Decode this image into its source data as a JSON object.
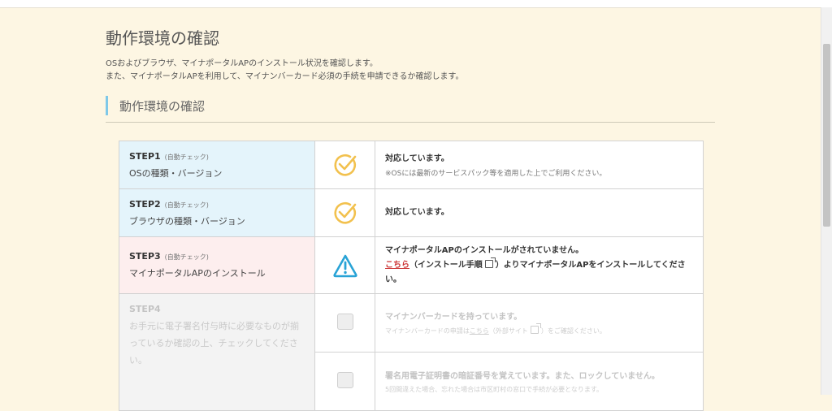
{
  "page": {
    "title": "動作環境の確認",
    "description_line1": "OSおよびブラウザ、マイナポータルAPのインストール状況を確認します。",
    "description_line2": "また、マイナポータルAPを利用して、マイナンバーカード必須の手続を申請できるか確認します。"
  },
  "section": {
    "title": "動作環境の確認"
  },
  "steps": [
    {
      "label": "STEP1",
      "tag": "(自動チェック)",
      "desc": "OSの種類・バージョン",
      "icon": "check-circle-icon",
      "main": "対応しています。",
      "note": "※OSには最新のサービスパック等を適用した上でご利用ください。"
    },
    {
      "label": "STEP2",
      "tag": "(自動チェック)",
      "desc": "ブラウザの種類・バージョン",
      "icon": "check-circle-icon",
      "main": "対応しています。"
    },
    {
      "label": "STEP3",
      "tag": "(自動チェック)",
      "desc": "マイナポータルAPのインストール",
      "icon": "warning-icon",
      "main": "マイナポータルAPのインストールがされていません。",
      "link": "こちら",
      "after_link_1": "（インストール手順",
      "after_link_2": "）よりマイナポータルAPをインストールしてください。"
    },
    {
      "label": "STEP4",
      "desc": "お手元に電子署名付与時に必要なものが揃っているか確認の上、チェックしてください。",
      "checks": [
        {
          "main": "マイナンバーカードを持っています。",
          "note_before": "マイナンバーカードの申請は",
          "note_link": "こちら",
          "note_mid": "（外部サイト",
          "note_after": "）をご確認ください。"
        },
        {
          "main": "署名用電子証明書の暗証番号を覚えています。また、ロックしていません。",
          "note": "5回間違えた場合、忘れた場合は市区町村の窓口で手続が必要となります。"
        }
      ]
    }
  ],
  "colors": {
    "page_bg": "#fdf6e3",
    "step_ok_bg": "#e4f4fb",
    "step_warn_bg": "#fdeeee",
    "step_disabled_bg": "#f3f3f3",
    "check_icon": "#f2c14e",
    "warning_icon": "#29a3d6",
    "section_accent": "#7fc8e8",
    "link": "#cc3333"
  }
}
